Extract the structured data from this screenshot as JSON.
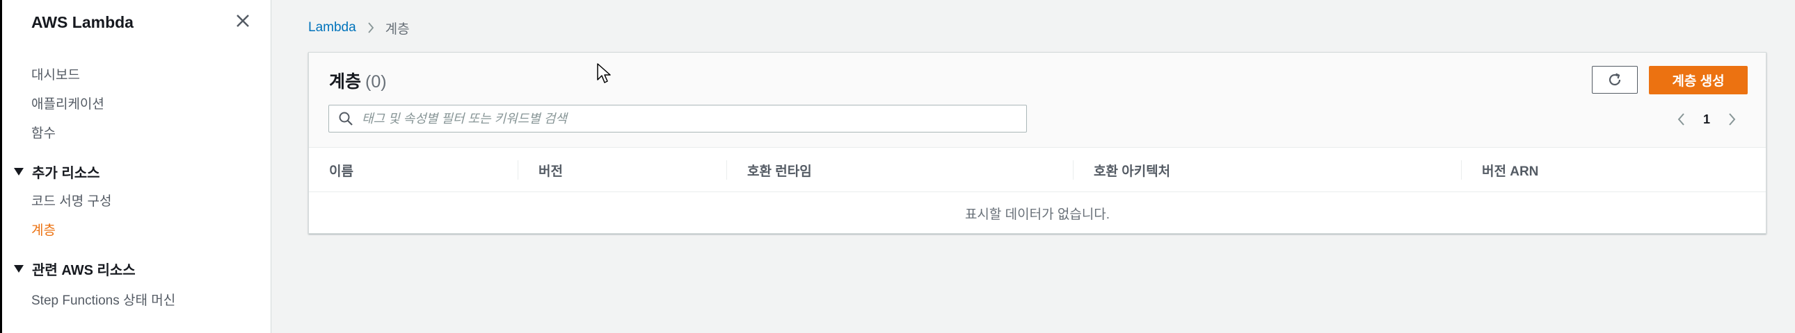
{
  "sidebar": {
    "title": "AWS Lambda",
    "items": [
      {
        "label": "대시보드"
      },
      {
        "label": "애플리케이션"
      },
      {
        "label": "함수"
      }
    ],
    "sections": [
      {
        "label": "추가 리소스",
        "items": [
          {
            "label": "코드 서명 구성"
          },
          {
            "label": "계층"
          }
        ]
      },
      {
        "label": "관련 AWS 리소스",
        "items": [
          {
            "label": "Step Functions 상태 머신"
          }
        ]
      }
    ]
  },
  "breadcrumb": {
    "root": "Lambda",
    "current": "계층"
  },
  "panel": {
    "title": "계층",
    "count": "(0)",
    "create_button": "계층 생성",
    "refresh_icon": "refresh-icon",
    "search_placeholder": "태그 및 속성별 필터 또는 키워드별 검색",
    "search_value": "",
    "page": "1"
  },
  "table": {
    "columns": [
      "이름",
      "버전",
      "호환 런타임",
      "호환 아키텍처",
      "버전 ARN"
    ],
    "empty_message": "표시할 데이터가 없습니다."
  },
  "colors": {
    "accent": "#ec7211",
    "link": "#0073bb",
    "background": "#f2f3f3"
  }
}
